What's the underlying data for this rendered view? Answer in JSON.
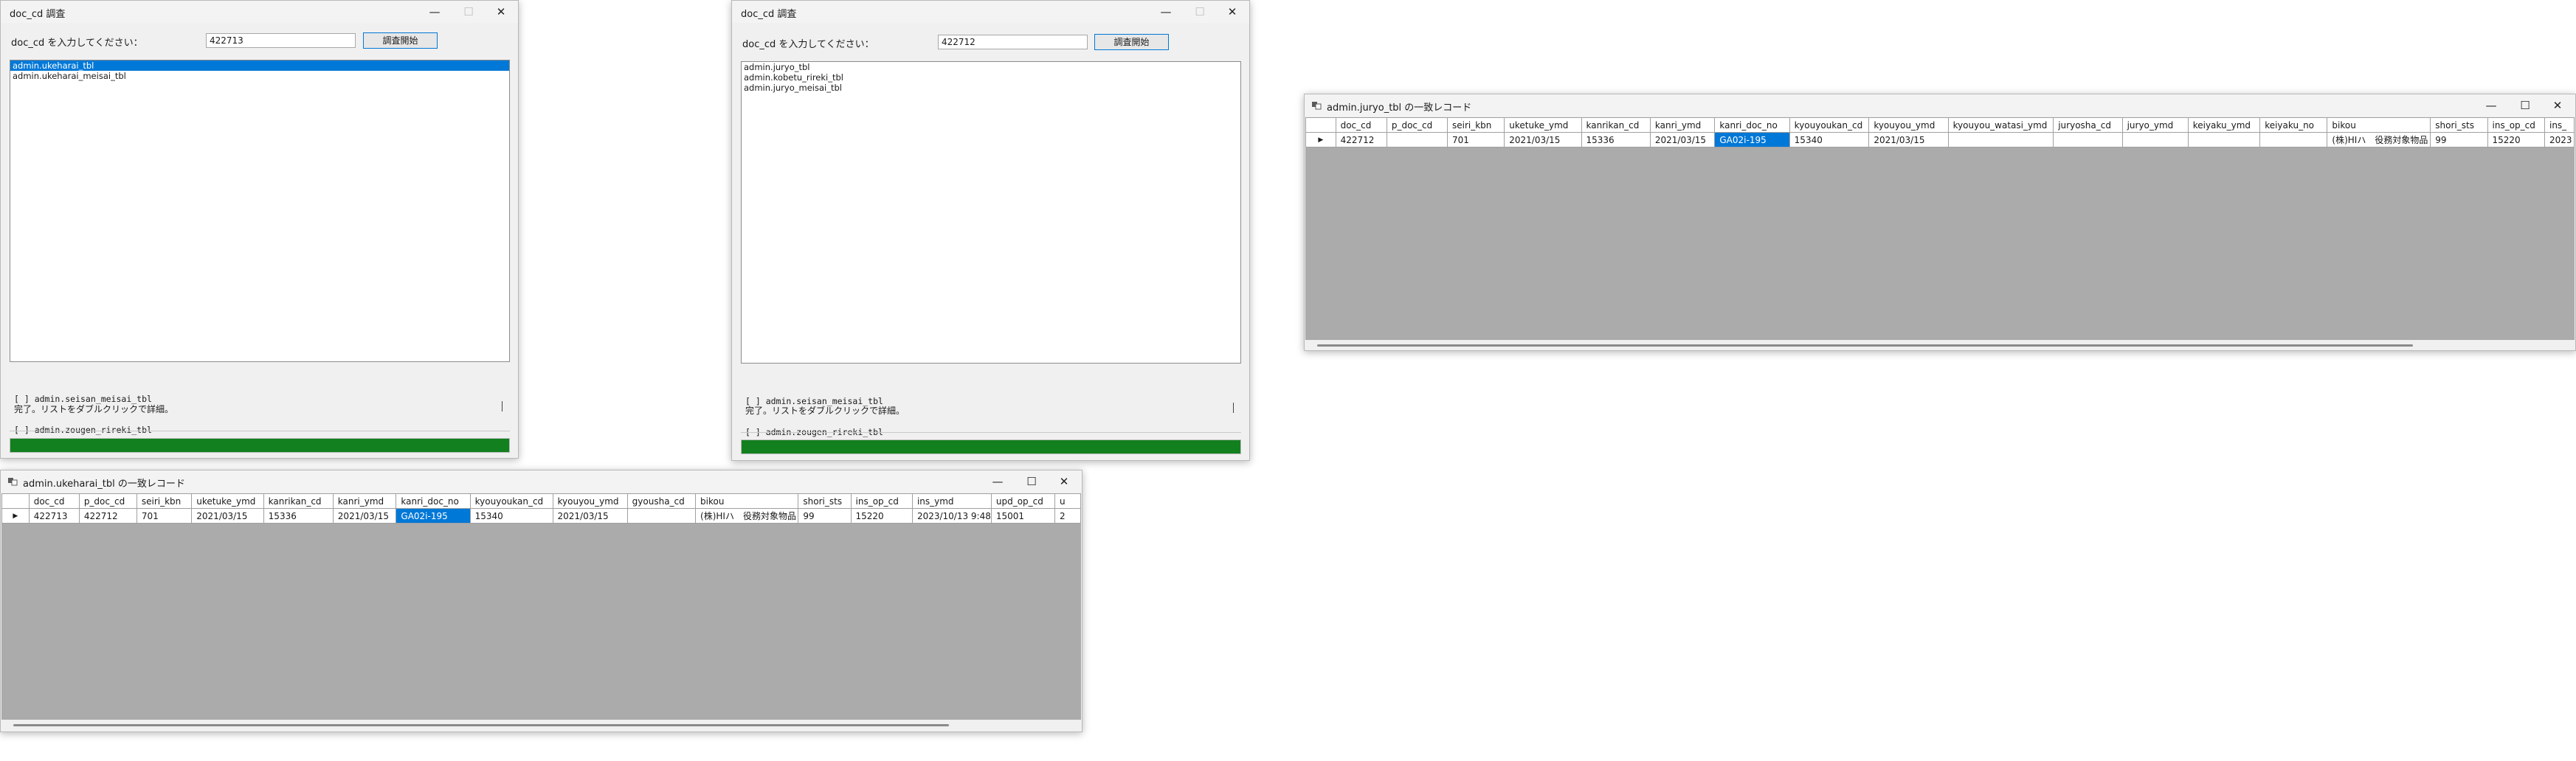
{
  "search1": {
    "title": "doc_cd 調査",
    "prompt": "doc_cd を入力してください：",
    "input_value": "422713",
    "start_button": "調査開始",
    "list": [
      "admin.ukeharai_tbl",
      "admin.ukeharai_meisai_tbl"
    ],
    "log": [
      "[ ] admin.seisan_meisai_tbl",
      "[ ] admin.zougen_rireki_tbl"
    ],
    "status": "完了。リストをダブルクリックで詳細。",
    "progress": 1.0
  },
  "search2": {
    "title": "doc_cd 調査",
    "prompt": "doc_cd を入力してください：",
    "input_value": "422712",
    "start_button": "調査開始",
    "list": [
      "admin.juryo_tbl",
      "admin.kobetu_rireki_tbl",
      "admin.juryo_meisai_tbl"
    ],
    "log": [
      "[ ] admin.seisan_meisai_tbl",
      "[ ] admin.zougen_rireki_tbl"
    ],
    "status": "完了。リストをダブルクリックで詳細。",
    "progress": 1.0
  },
  "grid_juryo": {
    "title": "admin.juryo_tbl の一致レコード",
    "row_marker": "▶",
    "columns": [
      "doc_cd",
      "p_doc_cd",
      "seiri_kbn",
      "uketuke_ymd",
      "kanrikan_cd",
      "kanri_ymd",
      "kanri_doc_no",
      "kyouyoukan_cd",
      "kyouyou_ymd",
      "kyouyou_watasi_ymd",
      "juryosha_cd",
      "juryo_ymd",
      "keiyaku_ymd",
      "keiyaku_no",
      "bikou",
      "shori_sts",
      "ins_op_cd",
      "ins_"
    ],
    "row": [
      "422712",
      "",
      "701",
      "2021/03/15",
      "15336",
      "2021/03/15",
      "GA02i-195",
      "15340",
      "2021/03/15",
      "",
      "",
      "",
      "",
      "",
      "(株)HIハ　役務対象物品",
      "99",
      "15220",
      "2023"
    ]
  },
  "grid_ukeharai": {
    "title": "admin.ukeharai_tbl の一致レコード",
    "row_marker": "▶",
    "columns": [
      "doc_cd",
      "p_doc_cd",
      "seiri_kbn",
      "uketuke_ymd",
      "kanrikan_cd",
      "kanri_ymd",
      "kanri_doc_no",
      "kyouyoukan_cd",
      "kyouyou_ymd",
      "gyousha_cd",
      "bikou",
      "shori_sts",
      "ins_op_cd",
      "ins_ymd",
      "upd_op_cd",
      "u"
    ],
    "row": [
      "422713",
      "422712",
      "701",
      "2021/03/15",
      "15336",
      "2021/03/15",
      "GA02i-195",
      "15340",
      "2021/03/15",
      "",
      "(株)HIハ　役務対象物品",
      "99",
      "15220",
      "2023/10/13 9:48",
      "15001",
      "2"
    ]
  },
  "controls": {
    "minimize": "—",
    "maximize": "☐",
    "close": "✕"
  }
}
